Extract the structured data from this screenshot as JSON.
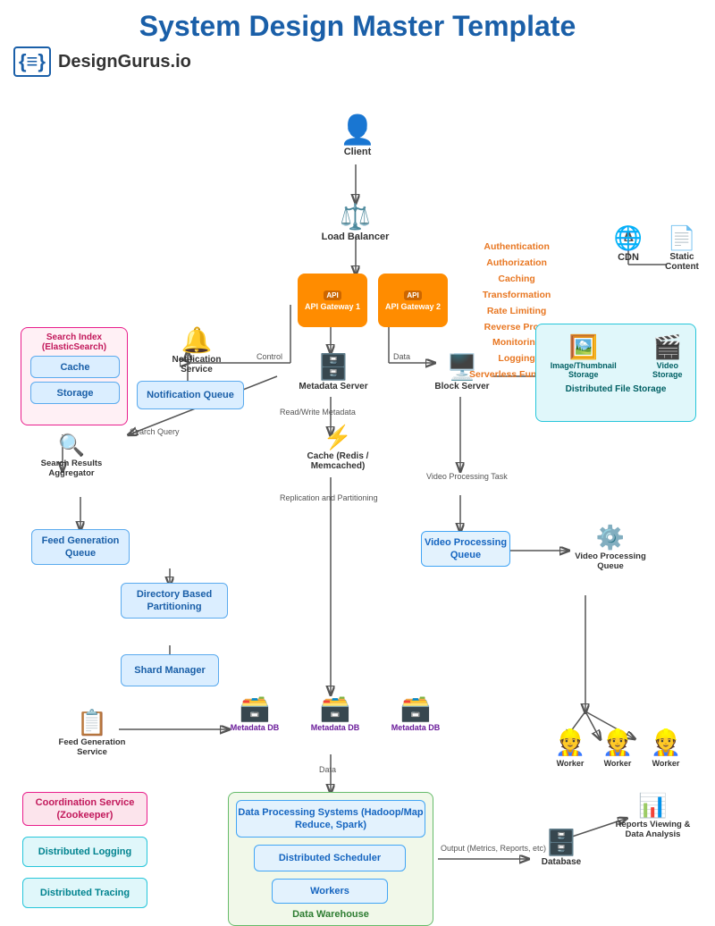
{
  "title": "System Design Master Template",
  "logo": {
    "icon": "{≡}",
    "text": "DesignGurus.io"
  },
  "nodes": {
    "client": "Client",
    "load_balancer": "Load Balancer",
    "cdn": "CDN",
    "static_content": "Static Content",
    "api_gateway_1": "API\nGateway 1",
    "api_gateway_2": "API\nGateway 2",
    "api_label": "API",
    "notification_service": "Notification Service",
    "notification_queue": "Notification Queue",
    "metadata_server": "Metadata Server",
    "block_server": "Block Server",
    "search_index": "Search Index\n(ElasticSearch)",
    "cache_inner": "Cache",
    "storage_inner": "Storage",
    "search_results": "Search Results\nAggregator",
    "feed_gen_queue": "Feed Generation\nQueue",
    "dir_partitioning": "Directory Based\nPartitioning",
    "shard_manager": "Shard Manager",
    "cache_redis": "Cache\n(Redis / Memcached)",
    "image_storage": "Image/Thumbnail\nStorage",
    "video_storage": "Video\nStorage",
    "dist_file_storage": "Distributed File Storage",
    "video_processing_queue_right": "Video Processing\nQueue",
    "video_processing_queue_label": "Video Processing\nQueue",
    "video_processing_queue_icon": "Video Processing\nQueue",
    "video_processing_task": "Video Processing\nTask",
    "worker1": "Worker",
    "worker2": "Worker",
    "worker3": "Worker",
    "metadata_db1": "Metadata DB",
    "metadata_db2": "Metadata DB",
    "metadata_db3": "Metadata DB",
    "feed_gen_service": "Feed Generation\nService",
    "coord_service": "Coordination Service\n(Zookeeper)",
    "dist_logging": "Distributed\nLogging",
    "dist_tracing": "Distributed\nTracing",
    "data_processing": "Data Processing Systems\n(Hadoop/Map Reduce, Spark)",
    "dist_scheduler": "Distributed Scheduler",
    "workers_dw": "Workers",
    "data_warehouse": "Data Warehouse",
    "database": "Database",
    "reports": "Reports Viewing\n& Data Analysis"
  },
  "orange_list": {
    "items": [
      "Authentication",
      "Authorization",
      "Caching",
      "Transformation",
      "Rate Limiting",
      "Reverse Proxy",
      "Monitoring",
      "Logging",
      "Serverless Functions"
    ]
  },
  "labels": {
    "control": "Control",
    "data": "Data",
    "search_query": "Search Query",
    "read_write_metadata": "Read/Write Metadata",
    "replication_partitioning": "Replication and\nPartitioning",
    "video_processing_task": "Video Processing\nTask",
    "output": "Output\n(Metrics, Reports, etc)"
  }
}
